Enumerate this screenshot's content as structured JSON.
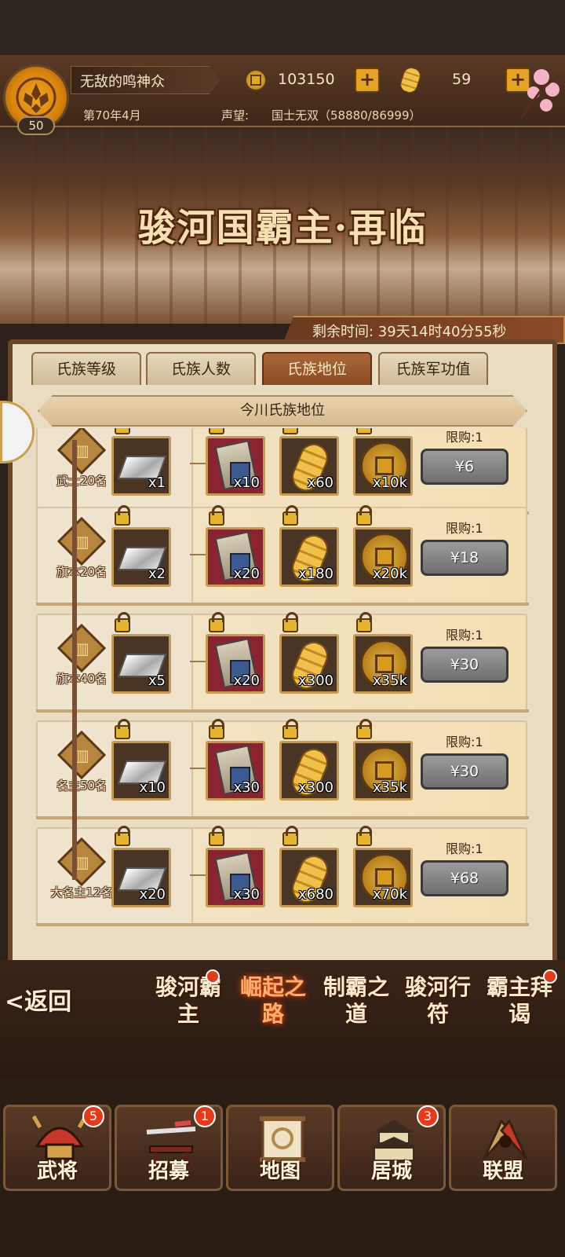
{
  "player": {
    "name": "无敌的鸣神众",
    "level": "50",
    "date": "第70年4月",
    "reputation_label": "声望:",
    "reputation_value": "国士无双（58880/86999）"
  },
  "resources": {
    "coins": "103150",
    "gold": "59"
  },
  "event": {
    "title": "骏河国霸主·再临",
    "time_remaining": "剩余时间: 39天14时40分55秒"
  },
  "tabs": [
    "氏族等级",
    "氏族人数",
    "氏族地位",
    "氏族军功值"
  ],
  "active_tab": "氏族地位",
  "section_title": "今川氏族地位",
  "rows": [
    {
      "rank": "武士20名",
      "items": [
        "x1",
        "x10",
        "x60",
        "x10k"
      ],
      "limit": "限购:1",
      "price": "¥6"
    },
    {
      "rank": "旗本20名",
      "items": [
        "x2",
        "x20",
        "x180",
        "x20k"
      ],
      "limit": "限购:1",
      "price": "¥18"
    },
    {
      "rank": "旗本40名",
      "items": [
        "x5",
        "x20",
        "x300",
        "x35k"
      ],
      "limit": "限购:1",
      "price": "¥30"
    },
    {
      "rank": "名主50名",
      "items": [
        "x10",
        "x30",
        "x300",
        "x35k"
      ],
      "limit": "限购:1",
      "price": "¥30"
    },
    {
      "rank": "大名主12名",
      "items": [
        "x20",
        "x30",
        "x680",
        "x70k"
      ],
      "limit": "限购:1",
      "price": "¥68"
    }
  ],
  "subnav": {
    "back": "<返回",
    "items": [
      "骏河霸主",
      "崛起之路",
      "制霸之道",
      "骏河行符",
      "霸主拜谒"
    ],
    "active": "崛起之路"
  },
  "bottom_nav": [
    {
      "label": "武将",
      "badge": "5"
    },
    {
      "label": "招募",
      "badge": "1"
    },
    {
      "label": "地图",
      "badge": ""
    },
    {
      "label": "居城",
      "badge": "3"
    },
    {
      "label": "联盟",
      "badge": ""
    }
  ]
}
